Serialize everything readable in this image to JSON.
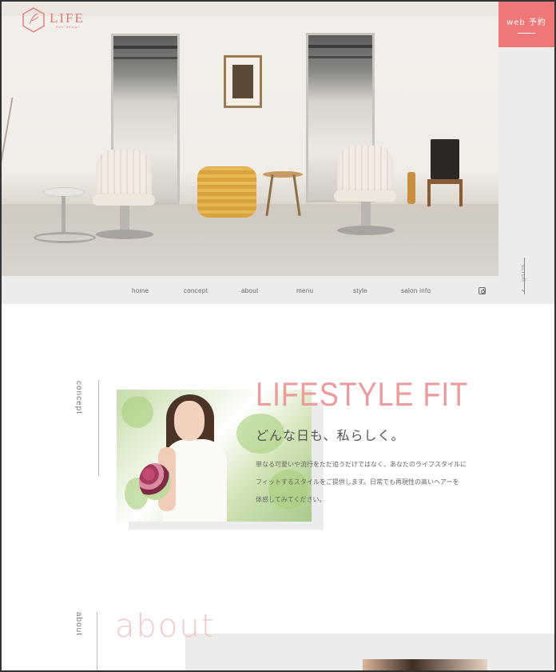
{
  "brand": {
    "name": "LIFE",
    "tagline": "hair design",
    "accent": "#ee7878"
  },
  "header": {
    "reserve_label": "web 予約"
  },
  "scroll": {
    "label": "scroll"
  },
  "nav": {
    "items": [
      {
        "label": "home"
      },
      {
        "label": "concept"
      },
      {
        "label": "about"
      },
      {
        "label": "menu"
      },
      {
        "label": "style"
      },
      {
        "label": "salon info"
      }
    ],
    "instagram_icon": "instagram-icon"
  },
  "hero": {
    "image": "salon-interior-photo"
  },
  "concept": {
    "section_label": "concept",
    "headline": "LIFESTYLE FIT",
    "subheadline": "どんな日も、私らしく。",
    "body_lines": [
      "単なる可愛いや流行をただ追うだけではなく、あなたのライフスタイルに",
      "フィットするスタイルをご提供します。日常でも再現性の高いヘアーを",
      "体感してみてください。"
    ],
    "image": "woman-with-bouquet-photo"
  },
  "about": {
    "section_label": "about",
    "title": "about"
  }
}
